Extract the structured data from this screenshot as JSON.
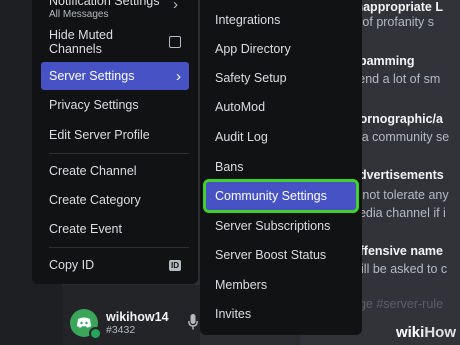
{
  "chat": {
    "lines": [
      {
        "text": "Inappropriate L",
        "head": true
      },
      {
        "text": "e of profanity s",
        "head": false
      },
      {
        "text": "spamming",
        "head": true
      },
      {
        "text": "send a lot of sm",
        "head": false
      },
      {
        "text": "pornographic/a",
        "head": true
      },
      {
        "text": "s a community se",
        "head": false
      },
      {
        "text": "advertisements",
        "head": true
      },
      {
        "text": "o not tolerate any",
        "head": false
      },
      {
        "text": "nedia channel if i",
        "head": false
      },
      {
        "text": "offensive name",
        "head": true
      },
      {
        "text": "will be asked to c",
        "head": false
      },
      {
        "text": "age #server-rule",
        "head": false
      }
    ]
  },
  "menu": {
    "notification_label": "Notification Settings",
    "notification_sub": "All Messages",
    "hide_muted": "Hide Muted Channels",
    "server_settings": "Server Settings",
    "privacy_settings": "Privacy Settings",
    "edit_profile": "Edit Server Profile",
    "create_channel": "Create Channel",
    "create_category": "Create Category",
    "create_event": "Create Event",
    "copy_id": "Copy ID",
    "id_badge": "ID"
  },
  "submenu": {
    "items": [
      "Integrations",
      "App Directory",
      "Safety Setup",
      "AutoMod",
      "Audit Log",
      "Bans",
      "Community Settings",
      "Server Subscriptions",
      "Server Boost Status",
      "Members",
      "Invites"
    ],
    "active_index": 6
  },
  "user": {
    "name": "wikihow14",
    "tag": "#3432"
  },
  "watermark": {
    "part1": "wiki",
    "part2": "How"
  },
  "colors": {
    "accent": "#4752c4",
    "highlight_outline": "#3fd12f",
    "menu_bg": "#111214"
  }
}
